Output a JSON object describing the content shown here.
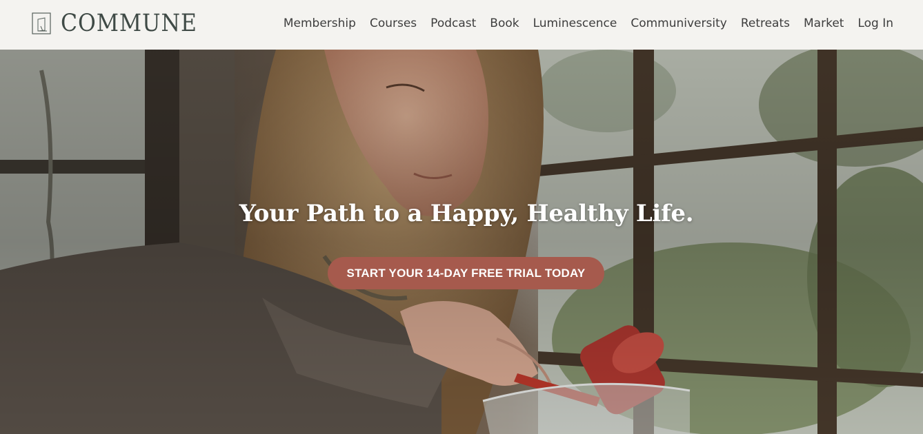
{
  "brand": {
    "name": "COMMUNE",
    "logo_icon": "door-frame-icon"
  },
  "nav": {
    "items": [
      {
        "label": "Membership"
      },
      {
        "label": "Courses"
      },
      {
        "label": "Podcast"
      },
      {
        "label": "Book"
      },
      {
        "label": "Luminescence"
      },
      {
        "label": "Communiversity"
      },
      {
        "label": "Retreats"
      },
      {
        "label": "Market"
      },
      {
        "label": "Log In"
      }
    ]
  },
  "hero": {
    "title": "Your Path to a Happy, Healthy Life.",
    "cta_label": "START YOUR 14-DAY FREE TRIAL TODAY"
  },
  "colors": {
    "header_bg": "#f4f3f0",
    "brand_text": "#3f4a46",
    "cta_bg": "#a65a4d"
  }
}
